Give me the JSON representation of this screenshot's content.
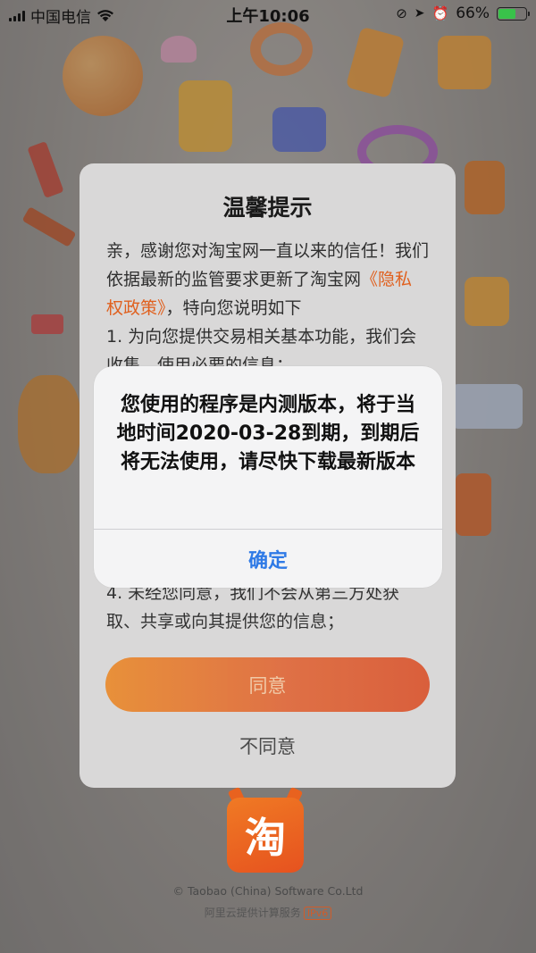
{
  "status_bar": {
    "carrier": "中国电信",
    "time": "上午10:06",
    "battery_percent": "66%",
    "battery_level": 0.66,
    "battery_color": "#39c24a"
  },
  "privacy_dialog": {
    "title": "温馨提示",
    "intro": "亲，感谢您对淘宝网一直以来的信任！我们依据最新的监管要求更新了淘宝网",
    "policy_link": "《隐私权政策》",
    "intro_tail": "，特向您说明如下",
    "item_1": "1. 为向您提供交易相关基本功能，我们会收集、使用必要的信息；",
    "item_4": "4. 未经您同意，我们不会从第三方处获取、共享或向其提供您的信息；",
    "agree_label": "同意",
    "disagree_label": "不同意",
    "accent_color": "#e0601e"
  },
  "footer": {
    "logo_char": "淘",
    "copyright": "© Taobao (China) Software Co.Ltd",
    "cloud_text": "阿里云提供计算服务",
    "ipv6_badge": "IPv6"
  },
  "alert": {
    "message": "您使用的程序是内测版本，将于当地时间2020-03-28到期，到期后将无法使用，请尽快下载最新版本",
    "confirm_label": "确定",
    "button_color": "#2f7ae6"
  }
}
